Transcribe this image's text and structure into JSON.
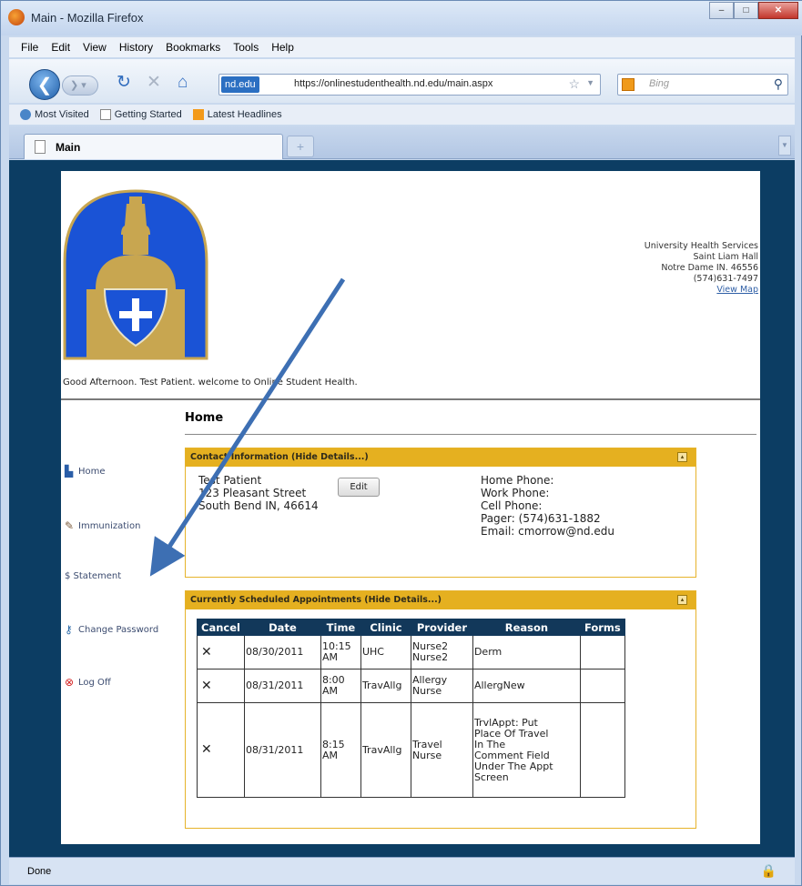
{
  "window": {
    "title": "Main - Mozilla Firefox",
    "controls": [
      "–",
      "□",
      "✕"
    ]
  },
  "menu": [
    "File",
    "Edit",
    "View",
    "History",
    "Bookmarks",
    "Tools",
    "Help"
  ],
  "nav": {
    "url_badge": "nd.edu",
    "url": "https://onlinestudenthealth.nd.edu/main.aspx",
    "search_placeholder": "Bing"
  },
  "bookmarks": [
    "Most Visited",
    "Getting Started",
    "Latest Headlines"
  ],
  "tab": {
    "label": "Main",
    "new_tab": "+"
  },
  "page": {
    "address": [
      "University Health Services",
      "Saint Liam Hall",
      "Notre Dame IN. 46556",
      "(574)631-7497"
    ],
    "view_map": "View Map",
    "welcome": "Good Afternoon. Test Patient. welcome to Online Student Health.",
    "heading": "Home",
    "sidebar": [
      "Home",
      "Immunization",
      "$ Statement",
      "Change Password",
      "Log Off"
    ],
    "contact": {
      "header": "Contact Information (Hide Details...)",
      "toggle": "▴",
      "lines": [
        "Test Patient",
        "123 Pleasant Street",
        "South Bend IN, 46614"
      ],
      "edit_label": "Edit",
      "phones": [
        "Home Phone:",
        "Work Phone:",
        "Cell Phone:",
        "Pager: (574)631-1882",
        "Email: cmorrow@nd.edu"
      ]
    },
    "appointments": {
      "header": "Currently Scheduled Appointments (Hide Details...)",
      "toggle": "▴",
      "columns": [
        "Cancel",
        "Date",
        "Time",
        "Clinic",
        "Provider",
        "Reason",
        "Forms"
      ],
      "rows": [
        {
          "cancel": "✕",
          "date": "08/30/2011",
          "time": [
            "10:15",
            "AM"
          ],
          "clinic": "UHC",
          "provider": [
            "Nurse2",
            "Nurse2"
          ],
          "reason": [
            "Derm"
          ],
          "forms": ""
        },
        {
          "cancel": "✕",
          "date": "08/31/2011",
          "time": [
            "8:00",
            "AM"
          ],
          "clinic": "TravAllg",
          "provider": [
            "Allergy",
            "Nurse"
          ],
          "reason": [
            "AllergNew"
          ],
          "forms": ""
        },
        {
          "cancel": "✕",
          "date": "08/31/2011",
          "time": [
            "8:15",
            "AM"
          ],
          "clinic": "TravAllg",
          "provider": [
            "Travel",
            "Nurse"
          ],
          "reason": [
            "TrvlAppt: Put",
            "Place Of Travel",
            "In The",
            "Comment Field",
            "Under The Appt",
            "Screen"
          ],
          "forms": ""
        }
      ]
    }
  },
  "status": {
    "text": "Done"
  },
  "colors": {
    "page_frame": "#0c3d63",
    "panel_header": "#e5b020",
    "table_header": "#12385a",
    "annotation_arrow": "#3d6fb3"
  }
}
